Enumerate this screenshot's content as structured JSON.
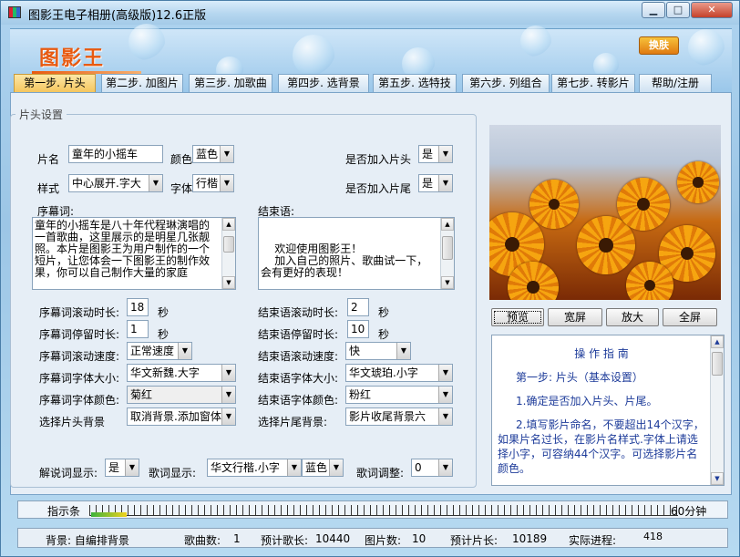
{
  "window": {
    "title": "图影王电子相册(高级版)12.6正版",
    "min_label": "▁",
    "max_label": "□",
    "close_label": "✕"
  },
  "banner": {
    "logo": "图影王",
    "skin_button": "换肤"
  },
  "tabs": [
    {
      "label": "第一步. 片头",
      "active": true
    },
    {
      "label": "第二步. 加图片"
    },
    {
      "label": "第三步. 加歌曲"
    },
    {
      "label": "第四步. 选背景"
    },
    {
      "label": "第五步. 选特技"
    },
    {
      "label": "第六步. 列组合"
    },
    {
      "label": "第七步. 转影片"
    },
    {
      "label": "帮助/注册"
    }
  ],
  "group_title": "片头设置",
  "form": {
    "name_label": "片名",
    "name_value": "童年的小摇车",
    "color_label": "颜色",
    "color_value": "蓝色",
    "style_label": "样式",
    "style_value": "中心展开.字大",
    "font_label": "字体",
    "font_value": "行楷",
    "add_head_label": "是否加入片头",
    "add_head_value": "是",
    "add_tail_label": "是否加入片尾",
    "add_tail_value": "是",
    "preface_label": "序幕词:",
    "preface_text": "    童年的小摇车是八十年代程琳演唱的一首歌曲，这里展示的是明星几张靓照。本片是图影王为用户制作的一个短片，让您体会一下图影王的制作效果，你可以自己制作大量的家庭",
    "ending_label": "结束语:",
    "ending_text": "\n    欢迎使用图影王！\n    加入自己的照片、歌曲试一下，会有更好的表现！",
    "preface_scroll_label": "序幕词滚动时长:",
    "preface_scroll_value": "18",
    "preface_stay_label": "序幕词停留时长:",
    "preface_stay_value": "1",
    "preface_speed_label": "序幕词滚动速度:",
    "preface_speed_value": "正常速度",
    "preface_fontsize_label": "序幕词字体大小:",
    "preface_fontsize_value": "华文新魏.大字",
    "preface_fontcolor_label": "序幕词字体颜色:",
    "preface_fontcolor_value": "菊红",
    "head_bg_label": "选择片头背景",
    "head_bg_value": "取消背景.添加窗体",
    "ending_scroll_label": "结束语滚动时长:",
    "ending_scroll_value": "2",
    "ending_stay_label": "结束语停留时长:",
    "ending_stay_value": "10",
    "ending_speed_label": "结束语滚动速度:",
    "ending_speed_value": "快",
    "ending_fontsize_label": "结束语字体大小:",
    "ending_fontsize_value": "华文琥珀.小字",
    "ending_fontcolor_label": "结束语字体颜色:",
    "ending_fontcolor_value": "粉红",
    "tail_bg_label": "选择片尾背景:",
    "tail_bg_value": "影片收尾背景六",
    "seconds": "秒",
    "subtitle_label": "解说词显示:",
    "subtitle_value": "是",
    "lyrics_label": "歌词显示:",
    "lyrics_font_value": "华文行楷.小字",
    "lyrics_color_value": "蓝色",
    "lyrics_adjust_label": "歌词调整:",
    "lyrics_adjust_value": "0"
  },
  "preview_buttons": [
    "预览",
    "宽屏",
    "放大",
    "全屏"
  ],
  "guide": {
    "title": "操 作 指 南",
    "step": "第一步: 片头（基本设置）",
    "p1": "1.确定是否加入片头、片尾。",
    "p2": "2.填写影片命名，不要超出14个汉字，如果片名过长，在影片名样式.字体上请选择小字，可容纳44个汉字。可选择影片名颜色。"
  },
  "indicator": {
    "label": "指示条",
    "right_label": "60分钟",
    "progress_fraction": 0.06
  },
  "status": {
    "bg": "背景: 自编排背景",
    "songs_label": "歌曲数:",
    "songs_value": "1",
    "song_len_label": "预计歌长:",
    "song_len_value": "10440",
    "pics_label": "图片数:",
    "pics_value": "10",
    "film_len_label": "预计片长:",
    "film_len_value": "10189",
    "progress_label": "实际进程:",
    "progress_value": "418"
  },
  "colors": {
    "accent_orange": "#e85a10",
    "guide_text": "#1e3c9a"
  }
}
